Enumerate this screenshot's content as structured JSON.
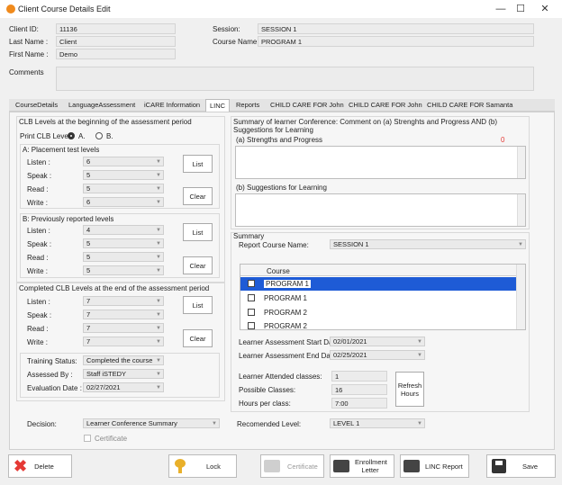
{
  "window": {
    "title": "Client Course Details Edit",
    "minimize": "—",
    "maximize": "☐",
    "close": "✕"
  },
  "header": {
    "client_id_label": "Client ID:",
    "client_id": "11136",
    "last_name_label": "Last Name :",
    "last_name": "Client",
    "first_name_label": "First Name :",
    "first_name": "Demo",
    "session_label": "Session:",
    "session": "SESSION 1",
    "course_name_label": "Course Name:",
    "course_name": "PROGRAM 1",
    "comments_label": "Comments"
  },
  "tabs": [
    "CourseDetails",
    "LanguageAssessment",
    "iCARE Information",
    "LINC",
    "Reports",
    "CHILD CARE FOR John",
    "CHILD CARE FOR John",
    "CHILD CARE FOR Samanta"
  ],
  "left": {
    "clb_begin_title": "CLB Levels at the beginning of the assessment period",
    "print_clb_label": "Print CLB Level",
    "radio_a": "A.",
    "radio_b": "B.",
    "placement_title": "A: Placement test levels",
    "prev_title": "B: Previously reported levels",
    "end_title": "Completed CLB Levels at the end of the assessment period",
    "listen_label": "Listen :",
    "speak_label": "Speak :",
    "read_label": "Read :",
    "write_label": "Write :",
    "placement": {
      "listen": "6",
      "speak": "5",
      "read": "5",
      "write": "6"
    },
    "previous": {
      "listen": "4",
      "speak": "5",
      "read": "5",
      "write": "5"
    },
    "end": {
      "listen": "7",
      "speak": "7",
      "read": "7",
      "write": "7"
    },
    "list_btn": "List",
    "clear_btn": "Clear",
    "training_status_label": "Training Status:",
    "training_status": "Completed the course",
    "assessed_by_label": "Assessed By :",
    "assessed_by": "Staff iSTEDY",
    "eval_date_label": "Evaluation Date :",
    "eval_date": "02/27/2021"
  },
  "right": {
    "summary_title": "Summary of learner Conference: Comment on (a) Strenghts and Progress AND (b) Suggestions for Learning",
    "strengths_label": "(a) Strengths and Progress",
    "strengths_count": "0",
    "suggestions_label": "(b) Suggestions for Learning",
    "summary_label": "Summary",
    "report_course_label": "Report Course Name:",
    "report_course": "SESSION 1",
    "course_col": "Course",
    "courses": [
      {
        "name": "PROGRAM 1",
        "selected": true
      },
      {
        "name": "PROGRAM 1",
        "selected": false
      },
      {
        "name": "PROGRAM 2",
        "selected": false
      },
      {
        "name": "PROGRAM 2",
        "selected": false
      }
    ],
    "start_date_label": "Learner Assessment Start Date:",
    "start_date": "02/01/2021",
    "end_date_label": "Learner Assessment End Date:",
    "end_date": "02/25/2021",
    "attended_label": "Learner Attended classes:",
    "attended": "1",
    "possible_label": "Possible Classes:",
    "possible": "16",
    "hours_label": "Hours per class:",
    "hours": "7:00",
    "refresh_btn": "Refresh Hours"
  },
  "bottom_row": {
    "decision_label": "Decision:",
    "decision": "Learner Conference Summary",
    "certificate_check": "Certificate",
    "recommended_label": "Recomended Level:",
    "recommended": "LEVEL 1"
  },
  "footer": {
    "delete": "Delete",
    "lock": "Lock",
    "certificate": "Certificate",
    "enrollment": "Enrollment Letter",
    "linc_report": "LINC Report",
    "save": "Save"
  },
  "colors": {
    "delete_icon": "#e53935",
    "lock_icon": "#e9b02a",
    "active_check": "#1e5bd6",
    "strength_count": "#e53935"
  }
}
